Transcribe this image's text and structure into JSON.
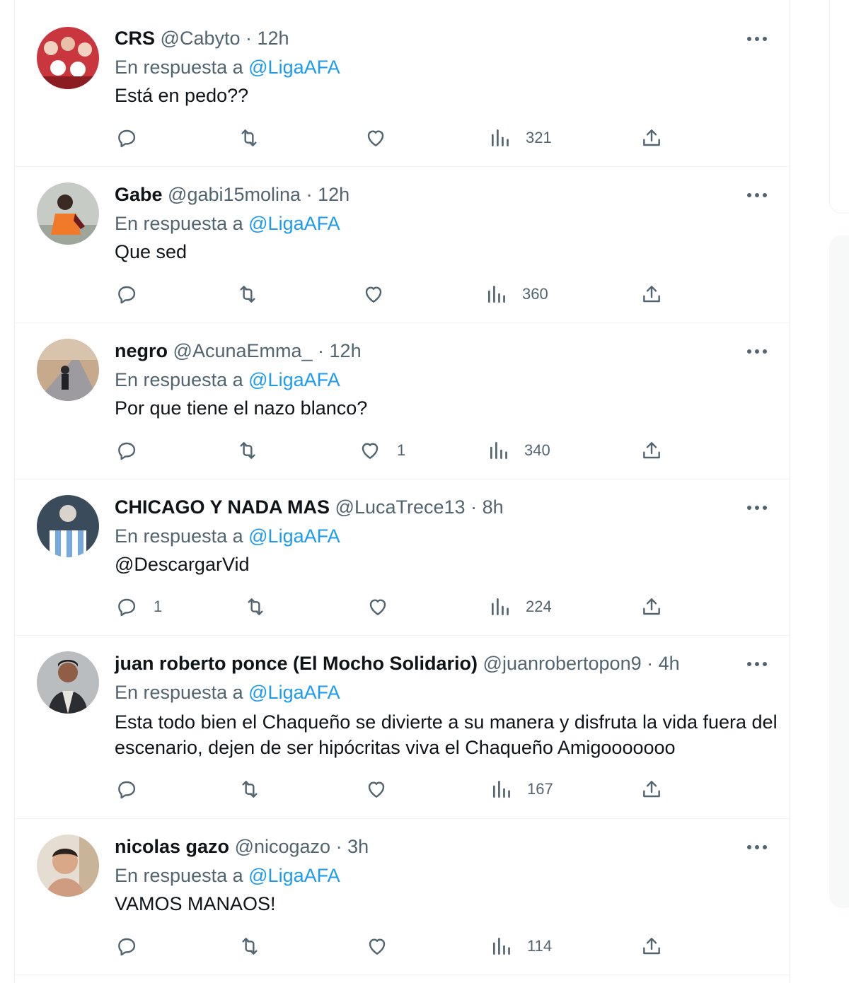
{
  "reply_prefix": "En respuesta a",
  "tweets": [
    {
      "name": "CRS",
      "handle": "@Cabyto",
      "time": "· 12h",
      "reply_to": "@LigaAFA",
      "text": "Está en pedo??",
      "text_is_mention": false,
      "replies": "",
      "likes": "",
      "views": "321",
      "avatar": "crowd-avatar"
    },
    {
      "name": "Gabe",
      "handle": "@gabi15molina",
      "time": "· 12h",
      "reply_to": "@LigaAFA",
      "text": "Que sed",
      "text_is_mention": false,
      "replies": "",
      "likes": "",
      "views": "360",
      "avatar": "orange-shirt-avatar"
    },
    {
      "name": "negro",
      "handle": "@AcunaEmma_",
      "time": "· 12h",
      "reply_to": "@LigaAFA",
      "text": "Por que tiene el nazo blanco?",
      "text_is_mention": false,
      "replies": "",
      "likes": "1",
      "views": "340",
      "avatar": "road-avatar"
    },
    {
      "name": "CHICAGO Y NADA MAS",
      "handle": "@LucaTrece13",
      "time": "· 8h",
      "reply_to": "@LigaAFA",
      "text": "@DescargarVid",
      "text_is_mention": true,
      "replies": "1",
      "likes": "",
      "views": "224",
      "avatar": "argentina-jersey-avatar"
    },
    {
      "name": "juan roberto ponce (El Mocho Solidario)",
      "handle": "@juanrobertopon9",
      "time": "· 4h",
      "reply_to": "@LigaAFA",
      "text": "Esta todo bien el Chaqueño se divierte a su manera y disfruta la vida fuera del escenario, dejen de ser hipócritas viva el Chaqueño Amigooooooo",
      "text_is_mention": false,
      "replies": "",
      "likes": "",
      "views": "167",
      "avatar": "man-portrait-avatar"
    },
    {
      "name": "nicolas gazo",
      "handle": "@nicogazo",
      "time": "· 3h",
      "reply_to": "@LigaAFA",
      "text": "VAMOS MANAOS!",
      "text_is_mention": false,
      "replies": "",
      "likes": "",
      "views": "114",
      "avatar": "selfie-avatar"
    }
  ],
  "colors": {
    "accent": "#1d9bf0",
    "muted": "#536471",
    "text": "#0f1419",
    "border": "#eff3f4"
  }
}
